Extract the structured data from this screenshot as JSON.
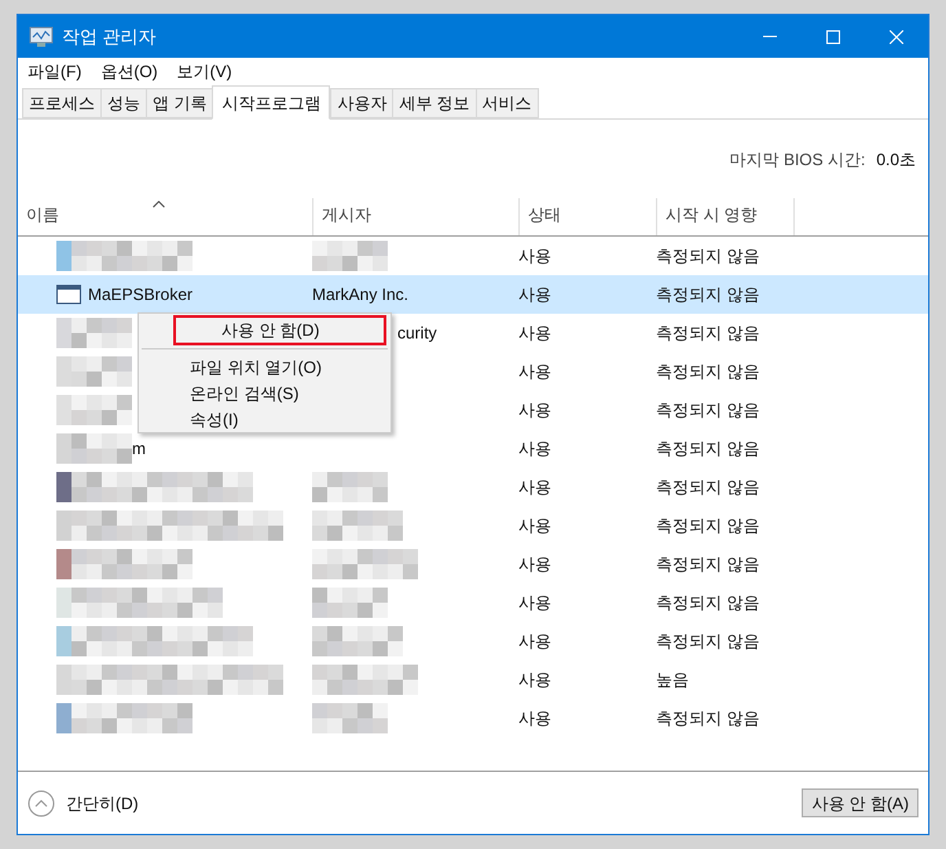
{
  "window": {
    "title": "작업 관리자"
  },
  "menu_bar": [
    "파일(F)",
    "옵션(O)",
    "보기(V)"
  ],
  "tabs": [
    {
      "label": "프로세스",
      "selected": false
    },
    {
      "label": "성능",
      "selected": false
    },
    {
      "label": "앱 기록",
      "selected": false
    },
    {
      "label": "시작프로그램",
      "selected": true
    },
    {
      "label": "사용자",
      "selected": false
    },
    {
      "label": "세부 정보",
      "selected": false
    },
    {
      "label": "서비스",
      "selected": false
    }
  ],
  "bios": {
    "label": "마지막 BIOS 시간:",
    "value": "0.0초"
  },
  "table": {
    "columns": [
      "이름",
      "게시자",
      "상태",
      "시작 시 영향"
    ],
    "rows": [
      {
        "kind": "blurred",
        "status": "사용",
        "impact": "측정되지 않음",
        "selected": false
      },
      {
        "kind": "app",
        "name": "MaEPSBroker",
        "publisher": "MarkAny Inc.",
        "status": "사용",
        "impact": "측정되지 않음",
        "selected": true
      },
      {
        "kind": "covered",
        "publisher": "curity",
        "status": "사용",
        "impact": "측정되지 않음",
        "selected": false
      },
      {
        "kind": "covered",
        "status": "사용",
        "impact": "측정되지 않음",
        "selected": false
      },
      {
        "kind": "covered",
        "status": "사용",
        "impact": "측정되지 않음",
        "selected": false
      },
      {
        "kind": "covered",
        "name": "m",
        "status": "사용",
        "impact": "측정되지 않음",
        "selected": false
      },
      {
        "kind": "blurred",
        "status": "사용",
        "impact": "측정되지 않음",
        "selected": false
      },
      {
        "kind": "blurred",
        "status": "사용",
        "impact": "측정되지 않음",
        "selected": false
      },
      {
        "kind": "blurred",
        "status": "사용",
        "impact": "측정되지 않음",
        "selected": false
      },
      {
        "kind": "blurred",
        "status": "사용",
        "impact": "측정되지 않음",
        "selected": false
      },
      {
        "kind": "blurred",
        "status": "사용",
        "impact": "측정되지 않음",
        "selected": false
      },
      {
        "kind": "blurred",
        "status": "사용",
        "impact": "높음",
        "selected": false
      },
      {
        "kind": "blurred",
        "status": "사용",
        "impact": "측정되지 않음",
        "selected": false
      }
    ]
  },
  "context_menu": {
    "items": [
      {
        "kind": "item",
        "label": "사용 안 함(D)",
        "selected": true
      },
      {
        "kind": "separator"
      },
      {
        "kind": "item",
        "label": "파일 위치 열기(O)",
        "selected": false
      },
      {
        "kind": "item",
        "label": "온라인 검색(S)",
        "selected": false
      },
      {
        "kind": "item",
        "label": "속성(I)",
        "selected": false
      }
    ]
  },
  "footer": {
    "toggle": "간단히(D)",
    "button": "사용 안 함(A)"
  }
}
